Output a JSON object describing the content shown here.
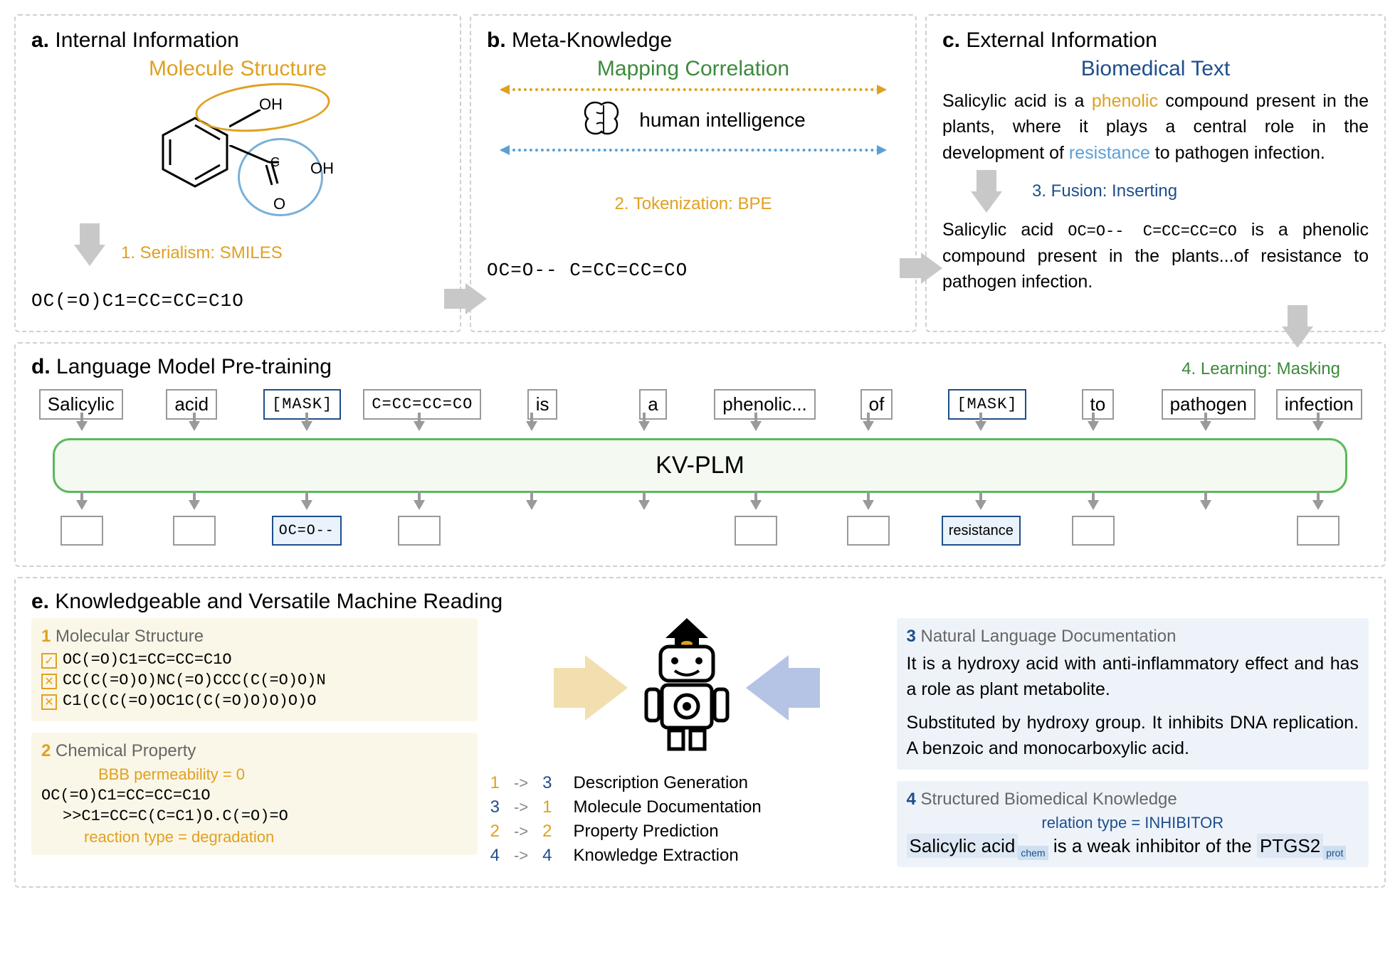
{
  "panels": {
    "a": {
      "letter": "a.",
      "title": "Internal Information",
      "subtitle": "Molecule Structure",
      "mol_labels": {
        "oh": "OH",
        "o_double": "O",
        "oh2": "OH",
        "c": "C"
      },
      "step1": "1. Serialism: SMILES",
      "smiles": "OC(=O)C1=CC=CC=C1O"
    },
    "b": {
      "letter": "b.",
      "title": "Meta-Knowledge",
      "subtitle": "Mapping Correlation",
      "human": "human intelligence",
      "step2": "2. Tokenization: BPE",
      "bpe": "OC=O--  C=CC=CC=CO"
    },
    "c": {
      "letter": "c.",
      "title": "External Information",
      "subtitle": "Biomedical Text",
      "para1_pre": "Salicylic acid is a ",
      "para1_ph": "phenolic",
      "para1_mid": " compound present in the plants, where it plays a central role in the development of ",
      "para1_res": "resistance",
      "para1_end": " to pathogen infection.",
      "step3": "3. Fusion: Inserting",
      "fused_pre": "Salicylic acid ",
      "fused_sm": "OC=O--  C=CC=CC=CO",
      "fused_post": " is a phenolic compound present in the plants...of resistance to pathogen infection."
    },
    "d": {
      "letter": "d.",
      "title": "Language Model Pre-training",
      "step4": "4. Learning: Masking",
      "tokens_in": [
        "Salicylic",
        "acid",
        "[MASK]",
        "C=CC=CC=CO",
        "is",
        "a",
        "phenolic...",
        "of",
        "[MASK]",
        "to",
        "pathogen",
        "infection"
      ],
      "model": "KV-PLM",
      "out_mask1": "OC=O--",
      "out_mask2": "resistance"
    },
    "e": {
      "letter": "e.",
      "title": "Knowledgeable and Versatile Machine Reading",
      "sub1": {
        "num": "1",
        "title": "Molecular Structure",
        "rows": [
          {
            "mark": "check",
            "text": "OC(=O)C1=CC=CC=C1O"
          },
          {
            "mark": "cross",
            "text": "CC(C(=O)O)NC(=O)CCC(C(=O)O)N"
          },
          {
            "mark": "cross",
            "text": "C1(C(C(=O)OC1C(C(=O)O)O)O)O"
          }
        ]
      },
      "sub2": {
        "num": "2",
        "title": "Chemical Property",
        "bbb": "BBB permeability = 0",
        "sm1": "OC(=O)C1=CC=CC=C1O",
        "sm2": ">>C1=CC=C(C=C1)O.C(=O)=O",
        "rxn": "reaction type = degradation"
      },
      "sub3": {
        "num": "3",
        "title": "Natural Language Documentation",
        "p1": "It is a hydroxy acid with anti-inflammatory effect and has a role as plant metabolite.",
        "p2": "Substituted by hydroxy group. It inhibits DNA replication. A benzoic and monocarboxylic acid."
      },
      "sub4": {
        "num": "4",
        "title": "Structured Biomedical Knowledge",
        "rel": "relation type = INHIBITOR",
        "sent_pre": "Salicylic acid",
        "sent_tag1": "chem",
        "sent_mid": "is a weak inhibitor of the ",
        "sent_ent": "PTGS2",
        "sent_tag2": "prot"
      },
      "mappings": [
        {
          "from": "1",
          "to": "3",
          "fcol": "orange",
          "tcol": "blue",
          "label": "Description Generation"
        },
        {
          "from": "3",
          "to": "1",
          "fcol": "blue",
          "tcol": "orange",
          "label": "Molecule Documentation"
        },
        {
          "from": "2",
          "to": "2",
          "fcol": "orange",
          "tcol": "orange",
          "label": "Property Prediction"
        },
        {
          "from": "4",
          "to": "4",
          "fcol": "blue",
          "tcol": "blue",
          "label": "Knowledge Extraction"
        }
      ]
    }
  }
}
